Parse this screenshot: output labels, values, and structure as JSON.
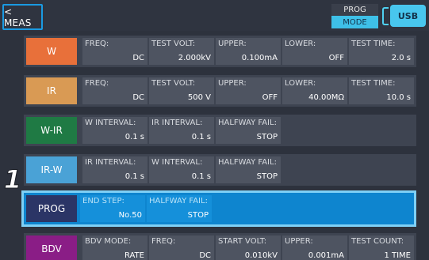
{
  "header": {
    "back_label": "< MEAS",
    "mode_top": "PROG",
    "mode_bottom": "MODE",
    "usb_label": "USB"
  },
  "step_marker": "1",
  "rows": [
    {
      "name": "w",
      "label": "W",
      "color": "#e8703a",
      "cells": [
        {
          "label": "FREQ:",
          "value": "DC"
        },
        {
          "label": "TEST VOLT:",
          "value": "2.000kV"
        },
        {
          "label": "UPPER:",
          "value": "0.100mA"
        },
        {
          "label": "LOWER:",
          "value": "OFF"
        },
        {
          "label": "TEST TIME:",
          "value": "2.0 s"
        }
      ]
    },
    {
      "name": "ir",
      "label": "IR",
      "color": "#d99a54",
      "cells": [
        {
          "label": "FREQ:",
          "value": "DC"
        },
        {
          "label": "TEST VOLT:",
          "value": "500 V"
        },
        {
          "label": "UPPER:",
          "value": "OFF"
        },
        {
          "label": "LOWER:",
          "value": "40.00MΩ"
        },
        {
          "label": "TEST TIME:",
          "value": "10.0 s"
        }
      ]
    },
    {
      "name": "w-ir",
      "label": "W-IR",
      "color": "#1f7a44",
      "cells": [
        {
          "label": "W INTERVAL:",
          "value": "0.1 s"
        },
        {
          "label": "IR INTERVAL:",
          "value": "0.1 s"
        },
        {
          "label": "HALFWAY FAIL:",
          "value": "STOP"
        }
      ]
    },
    {
      "name": "ir-w",
      "label": "IR-W",
      "color": "#4aa2d6",
      "cells": [
        {
          "label": "IR INTERVAL:",
          "value": "0.1 s"
        },
        {
          "label": "W INTERVAL:",
          "value": "0.1 s"
        },
        {
          "label": "HALFWAY FAIL:",
          "value": "STOP"
        }
      ]
    },
    {
      "name": "prog",
      "label": "PROG",
      "color": "#2b3566",
      "selected": true,
      "cells": [
        {
          "label": "END STEP:",
          "value": "No.50"
        },
        {
          "label": "HALFWAY FAIL:",
          "value": "STOP"
        }
      ]
    },
    {
      "name": "bdv",
      "label": "BDV",
      "color": "#8a1d86",
      "cells": [
        {
          "label": "BDV MODE:",
          "value": "RATE"
        },
        {
          "label": "FREQ:",
          "value": "DC"
        },
        {
          "label": "START VOLT:",
          "value": "0.010kV"
        },
        {
          "label": "UPPER:",
          "value": "0.001mA"
        },
        {
          "label": "TEST COUNT:",
          "value": "1 TIME"
        }
      ]
    }
  ]
}
